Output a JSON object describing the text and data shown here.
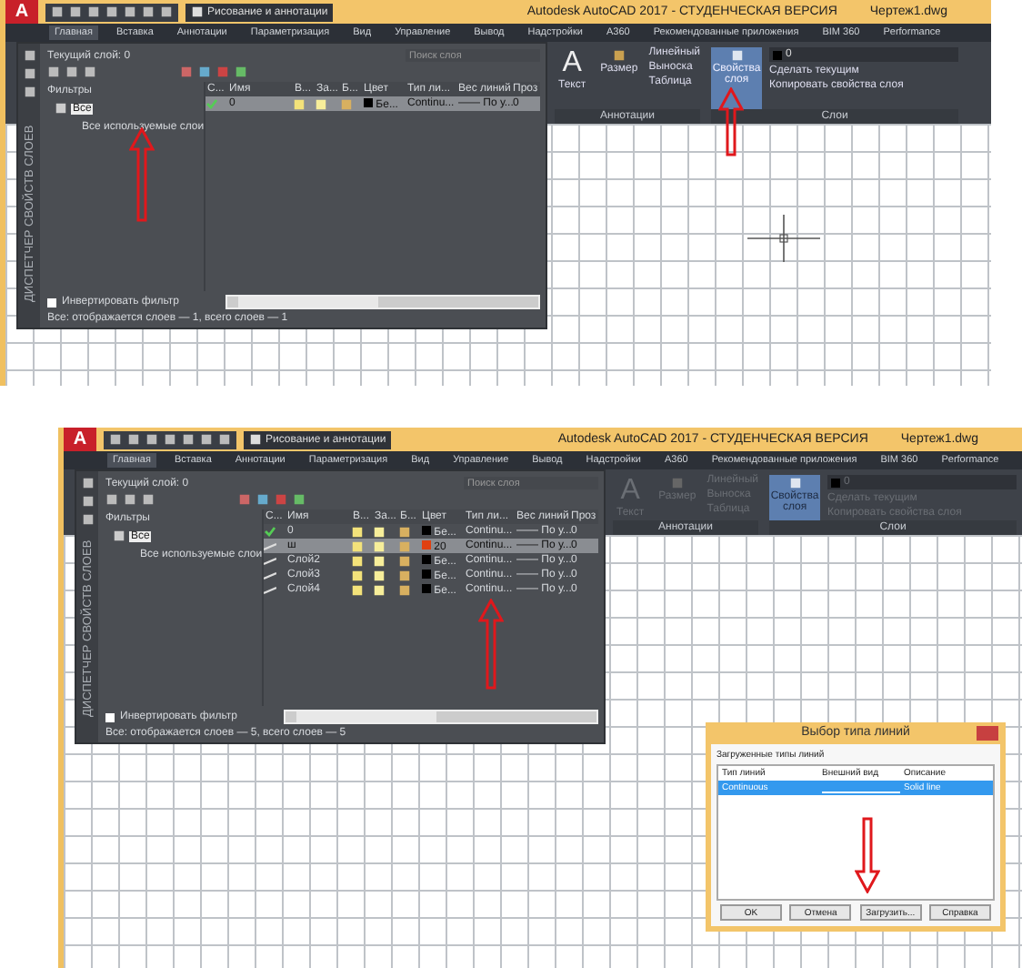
{
  "screens": [
    {
      "title_bar": {
        "logo": "A",
        "workspace": "Рисование и аннотации",
        "title": "Autodesk AutoCAD 2017 - СТУДЕНЧЕСКАЯ ВЕРСИЯ",
        "file": "Чертеж1.dwg"
      },
      "tabs": [
        {
          "label": "Главная",
          "selected": true
        },
        {
          "label": "Вставка",
          "selected": false
        },
        {
          "label": "Аннотации",
          "selected": false
        },
        {
          "label": "Параметризация",
          "selected": false
        },
        {
          "label": "Вид",
          "selected": false
        },
        {
          "label": "Управление",
          "selected": false
        },
        {
          "label": "Вывод",
          "selected": false
        },
        {
          "label": "Надстройки",
          "selected": false
        },
        {
          "label": "A360",
          "selected": false
        },
        {
          "label": "Рекомендованные приложения",
          "selected": false
        },
        {
          "label": "BIM 360",
          "selected": false
        },
        {
          "label": "Performance",
          "selected": false
        }
      ],
      "ribbon": {
        "disabled": false,
        "annotation_group": {
          "label": "Аннотации",
          "text_glyph": "A",
          "text_button": "Текст",
          "dimension_button": "Размер",
          "tools": [
            "Линейный",
            "Выноска",
            "Таблица"
          ]
        },
        "layers_group": {
          "label": "Слои",
          "properties_button": "Свойства слоя",
          "layer_dropdown": "0",
          "actions": [
            "Сделать текущим",
            "Копировать свойства слоя"
          ]
        }
      },
      "layer_palette": {
        "side_title": "ДИСПЕТЧЕР СВОЙСТВ СЛОЕВ",
        "current_layer": "Текущий слой: 0",
        "search_placeholder": "Поиск слоя",
        "filters_header": "Фильтры",
        "filters": [
          {
            "label": "Все",
            "selected": true,
            "children": [
              {
                "label": "Все используемые слои",
                "selected": false
              }
            ]
          }
        ],
        "columns": [
          "С...",
          "Имя",
          "В...",
          "За...",
          "Б...",
          "Цвет",
          "Тип ли...",
          "Вес линий",
          "Проз"
        ],
        "rows": [
          {
            "kind": "current",
            "name": "0",
            "color_name": "Бе...",
            "color": "#000000",
            "linetype": "Continu...",
            "lineweight": "—— По у...",
            "transparency": "0",
            "selected": true
          }
        ],
        "invert_filter": {
          "label": "Инвертировать фильтр",
          "checked": false
        },
        "status": "Все: отображается слоев — 1, всего слоев — 1"
      }
    },
    {
      "title_bar": {
        "logo": "A",
        "workspace": "Рисование и аннотации",
        "title": "Autodesk AutoCAD 2017 - СТУДЕНЧЕСКАЯ ВЕРСИЯ",
        "file": "Чертеж1.dwg"
      },
      "tabs": [
        {
          "label": "Главная",
          "selected": true
        },
        {
          "label": "Вставка",
          "selected": false
        },
        {
          "label": "Аннотации",
          "selected": false
        },
        {
          "label": "Параметризация",
          "selected": false
        },
        {
          "label": "Вид",
          "selected": false
        },
        {
          "label": "Управление",
          "selected": false
        },
        {
          "label": "Вывод",
          "selected": false
        },
        {
          "label": "Надстройки",
          "selected": false
        },
        {
          "label": "A360",
          "selected": false
        },
        {
          "label": "Рекомендованные приложения",
          "selected": false
        },
        {
          "label": "BIM 360",
          "selected": false
        },
        {
          "label": "Performance",
          "selected": false
        }
      ],
      "ribbon": {
        "disabled": true,
        "annotation_group": {
          "label": "Аннотации",
          "text_glyph": "A",
          "text_button": "Текст",
          "dimension_button": "Размер",
          "tools": [
            "Линейный",
            "Выноска",
            "Таблица"
          ]
        },
        "layers_group": {
          "label": "Слои",
          "properties_button": "Свойства слоя",
          "layer_dropdown": "0",
          "actions": [
            "Сделать текущим",
            "Копировать свойства слоя"
          ]
        }
      },
      "layer_palette": {
        "side_title": "ДИСПЕТЧЕР СВОЙСТВ СЛОЕВ",
        "current_layer": "Текущий слой: 0",
        "search_placeholder": "Поиск слоя",
        "filters_header": "Фильтры",
        "filters": [
          {
            "label": "Все",
            "selected": true,
            "children": [
              {
                "label": "Все используемые слои",
                "selected": false
              }
            ]
          }
        ],
        "columns": [
          "С...",
          "Имя",
          "В...",
          "За...",
          "Б...",
          "Цвет",
          "Тип ли...",
          "Вес линий",
          "Проз"
        ],
        "rows": [
          {
            "kind": "current",
            "name": "0",
            "color_name": "Бе...",
            "color": "#000000",
            "linetype": "Continu...",
            "lineweight": "—— По у...",
            "transparency": "0",
            "selected": false
          },
          {
            "kind": "layer",
            "name": "ш",
            "color_name": "20",
            "color": "#e04010",
            "linetype": "Continu...",
            "lineweight": "—— По у...",
            "transparency": "0",
            "selected": true
          },
          {
            "kind": "layer",
            "name": "Слой2",
            "color_name": "Бе...",
            "color": "#000000",
            "linetype": "Continu...",
            "lineweight": "—— По у...",
            "transparency": "0",
            "selected": false
          },
          {
            "kind": "layer",
            "name": "Слой3",
            "color_name": "Бе...",
            "color": "#000000",
            "linetype": "Continu...",
            "lineweight": "—— По у...",
            "transparency": "0",
            "selected": false
          },
          {
            "kind": "layer",
            "name": "Слой4",
            "color_name": "Бе...",
            "color": "#000000",
            "linetype": "Continu...",
            "lineweight": "—— По у...",
            "transparency": "0",
            "selected": false
          }
        ],
        "invert_filter": {
          "label": "Инвертировать фильтр",
          "checked": false
        },
        "status": "Все: отображается слоев — 5, всего слоев — 5"
      },
      "dialog": {
        "title": "Выбор типа линий",
        "section": "Загруженные типы линий",
        "columns": [
          "Тип линий",
          "Внешний вид",
          "Описание"
        ],
        "rows": [
          {
            "linetype": "Continuous",
            "description": "Solid line",
            "selected": true
          }
        ],
        "buttons": [
          "OK",
          "Отмена",
          "Загрузить...",
          "Справка"
        ]
      }
    }
  ]
}
